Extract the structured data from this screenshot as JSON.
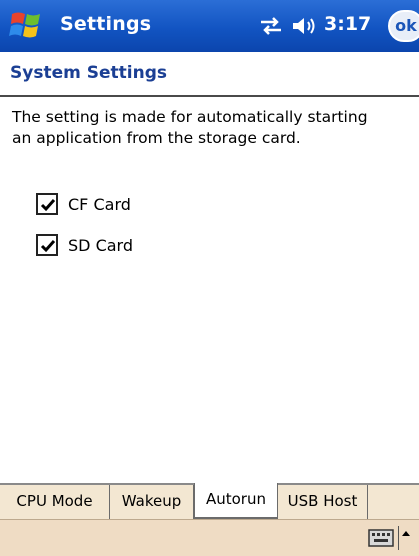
{
  "titlebar": {
    "app_title": "Settings",
    "clock": "3:17",
    "ok_label": "ok"
  },
  "header": {
    "title": "System Settings"
  },
  "content": {
    "description": "The setting is made for automatically starting an application from the storage card.",
    "options": [
      {
        "label": "CF Card",
        "checked": true
      },
      {
        "label": "SD Card",
        "checked": true
      }
    ]
  },
  "tabs": [
    {
      "label": "CPU Mode",
      "active": false
    },
    {
      "label": "Wakeup",
      "active": false
    },
    {
      "label": "Autorun",
      "active": true
    },
    {
      "label": "USB Host",
      "active": false
    }
  ],
  "colors": {
    "titlebar": "#1254c2",
    "header_text": "#1b3f94",
    "tab_strip": "#f3e7d2",
    "bottom_bar": "#efdcc4"
  },
  "icons": {
    "start": "windows-flag-icon",
    "connectivity": "connectivity-arrows-icon",
    "volume": "speaker-icon",
    "keyboard": "keyboard-icon",
    "sip": "up-arrow-icon"
  }
}
